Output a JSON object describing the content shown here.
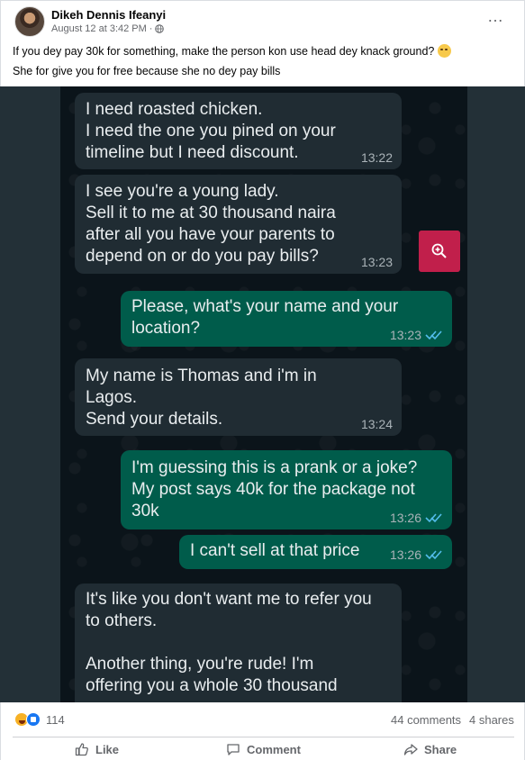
{
  "post": {
    "author": "Dikeh Dennis Ifeanyi",
    "timestamp": "August 12 at 3:42 PM",
    "caption_line1": "If you dey pay 30k for something, make the person kon use head dey knack ground?",
    "caption_line2": "She for give you for free because she no dey pay bills",
    "more_icon": "…"
  },
  "chat": {
    "messages": [
      {
        "direction": "incoming",
        "text": "I need roasted chicken.\nI need the one you pined on your\ntimeline but I need discount.",
        "time": "13:22"
      },
      {
        "direction": "incoming",
        "text": "I see you're a young lady.\nSell it to me at 30 thousand naira\nafter all you have your parents to\ndepend on or do you pay bills?",
        "time": "13:23"
      },
      {
        "direction": "outgoing",
        "text": "Please, what's your name and your\nlocation?",
        "time": "13:23"
      },
      {
        "direction": "incoming",
        "text": "My name is Thomas and i'm in\nLagos.\nSend your details.",
        "time": "13:24"
      },
      {
        "direction": "outgoing",
        "text": "I'm guessing this is a prank or a joke?\nMy post says 40k for the package not\n30k",
        "time": "13:26"
      },
      {
        "direction": "outgoing",
        "text": "I can't sell at that price",
        "time": "13:26"
      },
      {
        "direction": "incoming",
        "text": "It's like you don't want me to refer you\nto others.\n\nAnother thing, you're rude! I'm\noffering you a whole 30 thousand",
        "time": ""
      }
    ]
  },
  "stats": {
    "reaction_count": "114",
    "comments": "44 comments",
    "shares": "4 shares"
  },
  "actions": {
    "like": "Like",
    "comment": "Comment",
    "share": "Share"
  },
  "colors": {
    "incoming_bubble": "#202c33",
    "outgoing_bubble": "#005c4b",
    "zoom_button": "#c11f4b",
    "read_ticks": "#53bdeb"
  }
}
